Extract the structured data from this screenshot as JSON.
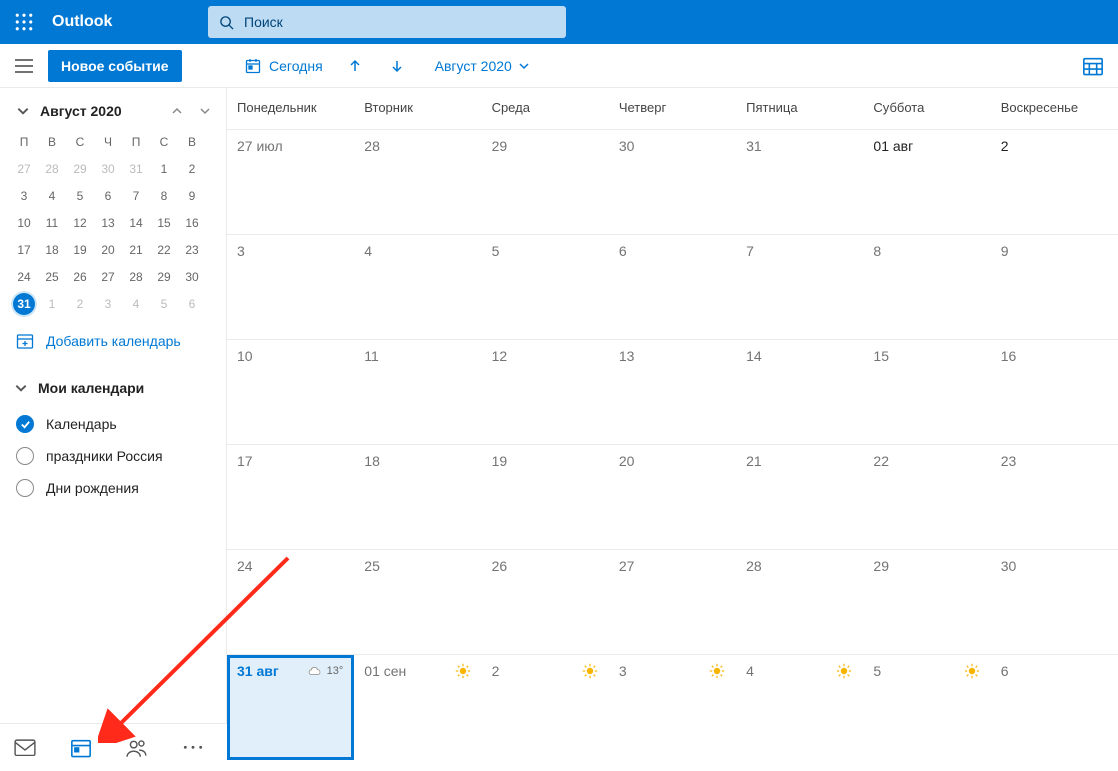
{
  "header": {
    "app_name": "Outlook",
    "search_placeholder": "Поиск"
  },
  "commands": {
    "new_event": "Новое событие",
    "today": "Сегодня",
    "month_label": "Август 2020"
  },
  "mini_calendar": {
    "title": "Август 2020",
    "day_headers": [
      "П",
      "В",
      "С",
      "Ч",
      "П",
      "С",
      "В"
    ],
    "weeks": [
      [
        {
          "d": "27",
          "out": true
        },
        {
          "d": "28",
          "out": true
        },
        {
          "d": "29",
          "out": true
        },
        {
          "d": "30",
          "out": true
        },
        {
          "d": "31",
          "out": true
        },
        {
          "d": "1"
        },
        {
          "d": "2"
        }
      ],
      [
        {
          "d": "3"
        },
        {
          "d": "4"
        },
        {
          "d": "5"
        },
        {
          "d": "6"
        },
        {
          "d": "7"
        },
        {
          "d": "8"
        },
        {
          "d": "9"
        }
      ],
      [
        {
          "d": "10"
        },
        {
          "d": "11"
        },
        {
          "d": "12"
        },
        {
          "d": "13"
        },
        {
          "d": "14"
        },
        {
          "d": "15"
        },
        {
          "d": "16"
        }
      ],
      [
        {
          "d": "17"
        },
        {
          "d": "18"
        },
        {
          "d": "19"
        },
        {
          "d": "20"
        },
        {
          "d": "21"
        },
        {
          "d": "22"
        },
        {
          "d": "23"
        }
      ],
      [
        {
          "d": "24"
        },
        {
          "d": "25"
        },
        {
          "d": "26"
        },
        {
          "d": "27"
        },
        {
          "d": "28"
        },
        {
          "d": "29"
        },
        {
          "d": "30"
        }
      ],
      [
        {
          "d": "31",
          "today": true
        },
        {
          "d": "1",
          "out": true
        },
        {
          "d": "2",
          "out": true
        },
        {
          "d": "3",
          "out": true
        },
        {
          "d": "4",
          "out": true
        },
        {
          "d": "5",
          "out": true
        },
        {
          "d": "6",
          "out": true
        }
      ]
    ]
  },
  "sidebar": {
    "add_calendar": "Добавить календарь",
    "section_title": "Мои календари",
    "calendars": [
      {
        "name": "Календарь",
        "checked": true
      },
      {
        "name": "праздники Россия",
        "checked": false
      },
      {
        "name": "Дни рождения",
        "checked": false
      }
    ]
  },
  "grid": {
    "day_headers": [
      "Понедельник",
      "Вторник",
      "Среда",
      "Четверг",
      "Пятница",
      "Суббота",
      "Воскресенье"
    ],
    "rows": [
      [
        {
          "label": "27 июл"
        },
        {
          "label": "28"
        },
        {
          "label": "29"
        },
        {
          "label": "30"
        },
        {
          "label": "31"
        },
        {
          "label": "01 авг",
          "dark": true
        },
        {
          "label": "2",
          "dark": true
        }
      ],
      [
        {
          "label": "3"
        },
        {
          "label": "4"
        },
        {
          "label": "5"
        },
        {
          "label": "6"
        },
        {
          "label": "7"
        },
        {
          "label": "8"
        },
        {
          "label": "9"
        }
      ],
      [
        {
          "label": "10"
        },
        {
          "label": "11"
        },
        {
          "label": "12"
        },
        {
          "label": "13"
        },
        {
          "label": "14"
        },
        {
          "label": "15"
        },
        {
          "label": "16"
        }
      ],
      [
        {
          "label": "17"
        },
        {
          "label": "18"
        },
        {
          "label": "19"
        },
        {
          "label": "20"
        },
        {
          "label": "21"
        },
        {
          "label": "22"
        },
        {
          "label": "23"
        }
      ],
      [
        {
          "label": "24"
        },
        {
          "label": "25"
        },
        {
          "label": "26"
        },
        {
          "label": "27"
        },
        {
          "label": "28"
        },
        {
          "label": "29"
        },
        {
          "label": "30"
        }
      ],
      [
        {
          "label": "31 авг",
          "today": true,
          "weather": {
            "icon": "cloud",
            "temp": "13°"
          }
        },
        {
          "label": "01 сен",
          "weather": {
            "icon": "sun"
          }
        },
        {
          "label": "2",
          "weather": {
            "icon": "sun"
          }
        },
        {
          "label": "3",
          "weather": {
            "icon": "sun"
          }
        },
        {
          "label": "4",
          "weather": {
            "icon": "sun"
          }
        },
        {
          "label": "5",
          "weather": {
            "icon": "sun"
          }
        },
        {
          "label": "6"
        }
      ]
    ]
  }
}
